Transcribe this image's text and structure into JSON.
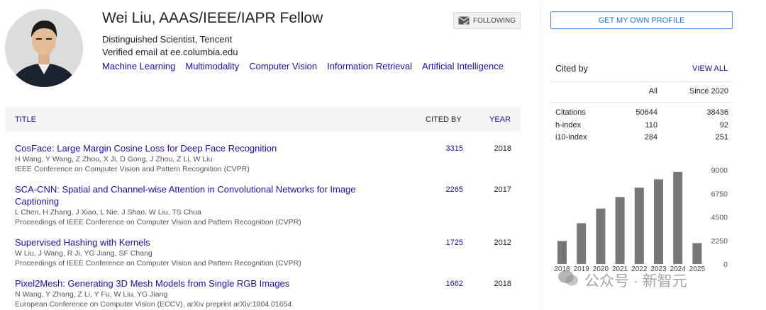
{
  "profile": {
    "name": "Wei Liu, AAAS/IEEE/IAPR Fellow",
    "affiliation": "Distinguished Scientist, Tencent",
    "email": "Verified email at ee.columbia.edu",
    "interests": [
      "Machine Learning",
      "Multimodality",
      "Computer Vision",
      "Information Retrieval",
      "Artificial Intelligence"
    ],
    "follow_label": "FOLLOWING"
  },
  "table": {
    "title_header": "TITLE",
    "cited_header": "CITED BY",
    "year_header": "YEAR",
    "rows": [
      {
        "title": "CosFace: Large Margin Cosine Loss for Deep Face Recognition",
        "authors": "H Wang, Y Wang, Z Zhou, X Ji, D Gong, J Zhou, Z Li, W Liu",
        "venue": "IEEE Conference on Computer Vision and Pattern Recognition (CVPR)",
        "cited": "3315",
        "year": "2018"
      },
      {
        "title": "SCA-CNN: Spatial and Channel-wise Attention in Convolutional Networks for Image Captioning",
        "authors": "L Chen, H Zhang, J Xiao, L Nie, J Shao, W Liu, TS Chua",
        "venue": "Proceedings of IEEE Conference on Computer Vision and Pattern Recognition (CVPR)",
        "cited": "2265",
        "year": "2017"
      },
      {
        "title": "Supervised Hashing with Kernels",
        "authors": "W Liu, J Wang, R Ji, YG Jiang, SF Chang",
        "venue": "Proceedings of IEEE Conference on Computer Vision and Pattern Recognition (CVPR)",
        "cited": "1725",
        "year": "2012"
      },
      {
        "title": "Pixel2Mesh: Generating 3D Mesh Models from Single RGB Images",
        "authors": "N Wang, Y Zhang, Z Li, Y Fu, W Liu, YG Jiang",
        "venue": "European Conference on Computer Vision (ECCV), arXiv preprint arXiv:1804.01654",
        "cited": "1662",
        "year": "2018"
      }
    ]
  },
  "sidebar": {
    "own_profile_label": "GET MY OWN PROFILE",
    "cited_by_title": "Cited by",
    "view_all_label": "VIEW ALL",
    "col_all": "All",
    "col_since": "Since 2020",
    "stats": [
      {
        "label": "Citations",
        "all": "50644",
        "since": "38436"
      },
      {
        "label": "h-index",
        "all": "110",
        "since": "92"
      },
      {
        "label": "i10-index",
        "all": "284",
        "since": "251"
      }
    ]
  },
  "chart_data": {
    "type": "bar",
    "categories": [
      "2018",
      "2019",
      "2020",
      "2021",
      "2022",
      "2023",
      "2024",
      "2025"
    ],
    "values": [
      2200,
      3900,
      5300,
      6400,
      7300,
      8100,
      8800,
      2000
    ],
    "yticks": [
      "9000",
      "6750",
      "4500",
      "2250",
      "0"
    ],
    "ylim": [
      0,
      9000
    ],
    "bar_color": "#777777"
  },
  "watermark": "公众号 · 新智元",
  "colors": {
    "link": "#1a0dab",
    "accent_button": "#4285f4"
  }
}
